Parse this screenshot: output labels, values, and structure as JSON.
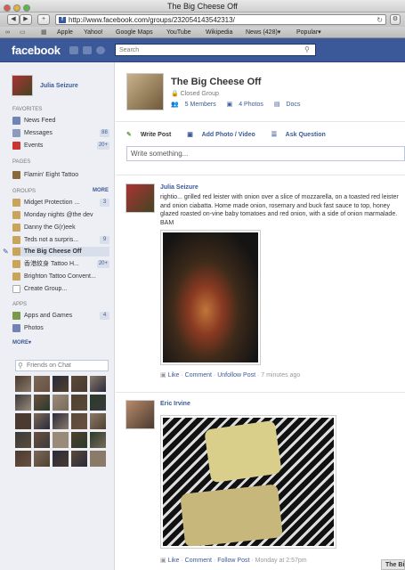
{
  "window": {
    "title": "The Big Cheese Off"
  },
  "browser": {
    "url": "http://www.facebook.com/groups/232054143542313/",
    "bookmarks": [
      "Apple",
      "Yahoo!",
      "Google Maps",
      "YouTube",
      "Wikipedia",
      "News (428)▾",
      "Popular▾"
    ]
  },
  "fb": {
    "logo": "facebook",
    "search_placeholder": "Search"
  },
  "sidebar": {
    "user_name": "Julia Seizure",
    "favorites_header": "FAVORITES",
    "favorites": [
      {
        "label": "News Feed",
        "count": ""
      },
      {
        "label": "Messages",
        "count": "88"
      },
      {
        "label": "Events",
        "count": "20+"
      }
    ],
    "pages_header": "PAGES",
    "pages": [
      {
        "label": "Flamin' Eight Tattoo"
      }
    ],
    "groups_header": "GROUPS",
    "groups_more": "MORE",
    "groups": [
      {
        "label": "Midget Protection ...",
        "count": "3"
      },
      {
        "label": "Monday nights @the dev",
        "count": ""
      },
      {
        "label": "Danny the G(r)eek",
        "count": ""
      },
      {
        "label": "Teds not a surpris...",
        "count": "9"
      },
      {
        "label": "The Big Cheese Off",
        "count": ""
      },
      {
        "label": "香港紋身 Tattoo H...",
        "count": "20+"
      },
      {
        "label": "Brighton Tattoo Convent...",
        "count": ""
      },
      {
        "label": "Create Group...",
        "count": ""
      }
    ],
    "apps_header": "APPS",
    "apps": [
      {
        "label": "Apps and Games",
        "count": "4"
      },
      {
        "label": "Photos",
        "count": ""
      }
    ],
    "more_link": "MORE▾",
    "chat_placeholder": "Friends on Chat"
  },
  "group": {
    "name": "The Big Cheese Off",
    "privacy": "Closed Group",
    "members": "5 Members",
    "photos": "4 Photos",
    "docs": "Docs"
  },
  "composer": {
    "write_post": "Write Post",
    "add_photo": "Add Photo / Video",
    "ask_question": "Ask Question",
    "placeholder": "Write something..."
  },
  "posts": [
    {
      "author": "Julia Seizure",
      "message": "rightio... grilled red leister with onion over a slice of mozzarella, on a toasted red leister and onion ciabatta. Home made onion, rosemary and buck fast sauce to top, honey glazed roasted on-vine baby tomatoes and red onion, with a side of onion marmalade. BAM",
      "like": "Like",
      "comment": "Comment",
      "follow": "Unfollow Post",
      "time": "7 minutes ago"
    },
    {
      "author": "Eric Irvine",
      "message": "",
      "like": "Like",
      "comment": "Comment",
      "follow": "Follow Post",
      "time": "Monday at 2:57pm"
    }
  ],
  "chat_tab": "The Big Cheese Off",
  "colors": {
    "fb_blue": "#3b5998",
    "sidebar_bg": "#edeff4"
  }
}
